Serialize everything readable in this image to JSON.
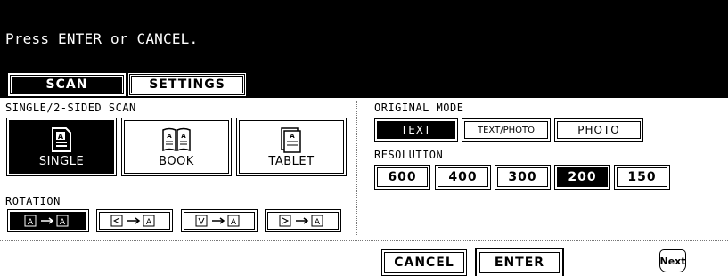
{
  "header": {
    "message": "Press ENTER or CANCEL."
  },
  "tabs": [
    {
      "label": "SCAN",
      "active": true
    },
    {
      "label": "SETTINGS",
      "active": false
    }
  ],
  "scan_mode": {
    "label": "SINGLE/2-SIDED SCAN",
    "options": [
      {
        "label": "SINGLE",
        "icon": "single-page-icon",
        "selected": true
      },
      {
        "label": "BOOK",
        "icon": "book-icon",
        "selected": false
      },
      {
        "label": "TABLET",
        "icon": "tablet-icon",
        "selected": false
      }
    ]
  },
  "rotation": {
    "label": "ROTATION",
    "options": [
      {
        "icon": "rotation-none-icon",
        "selected": true
      },
      {
        "icon": "rotation-left-icon",
        "selected": false
      },
      {
        "icon": "rotation-down-icon",
        "selected": false
      },
      {
        "icon": "rotation-right-icon",
        "selected": false
      }
    ]
  },
  "original_mode": {
    "label": "ORIGINAL MODE",
    "options": [
      {
        "label": "TEXT",
        "selected": true
      },
      {
        "label": "TEXT/PHOTO",
        "selected": false
      },
      {
        "label": "PHOTO",
        "selected": false
      }
    ]
  },
  "resolution": {
    "label": "RESOLUTION",
    "options": [
      {
        "label": "600",
        "selected": false
      },
      {
        "label": "400",
        "selected": false
      },
      {
        "label": "300",
        "selected": false
      },
      {
        "label": "200",
        "selected": true
      },
      {
        "label": "150",
        "selected": false
      }
    ]
  },
  "actions": {
    "cancel": "CANCEL",
    "enter": "ENTER",
    "next": "Next"
  }
}
